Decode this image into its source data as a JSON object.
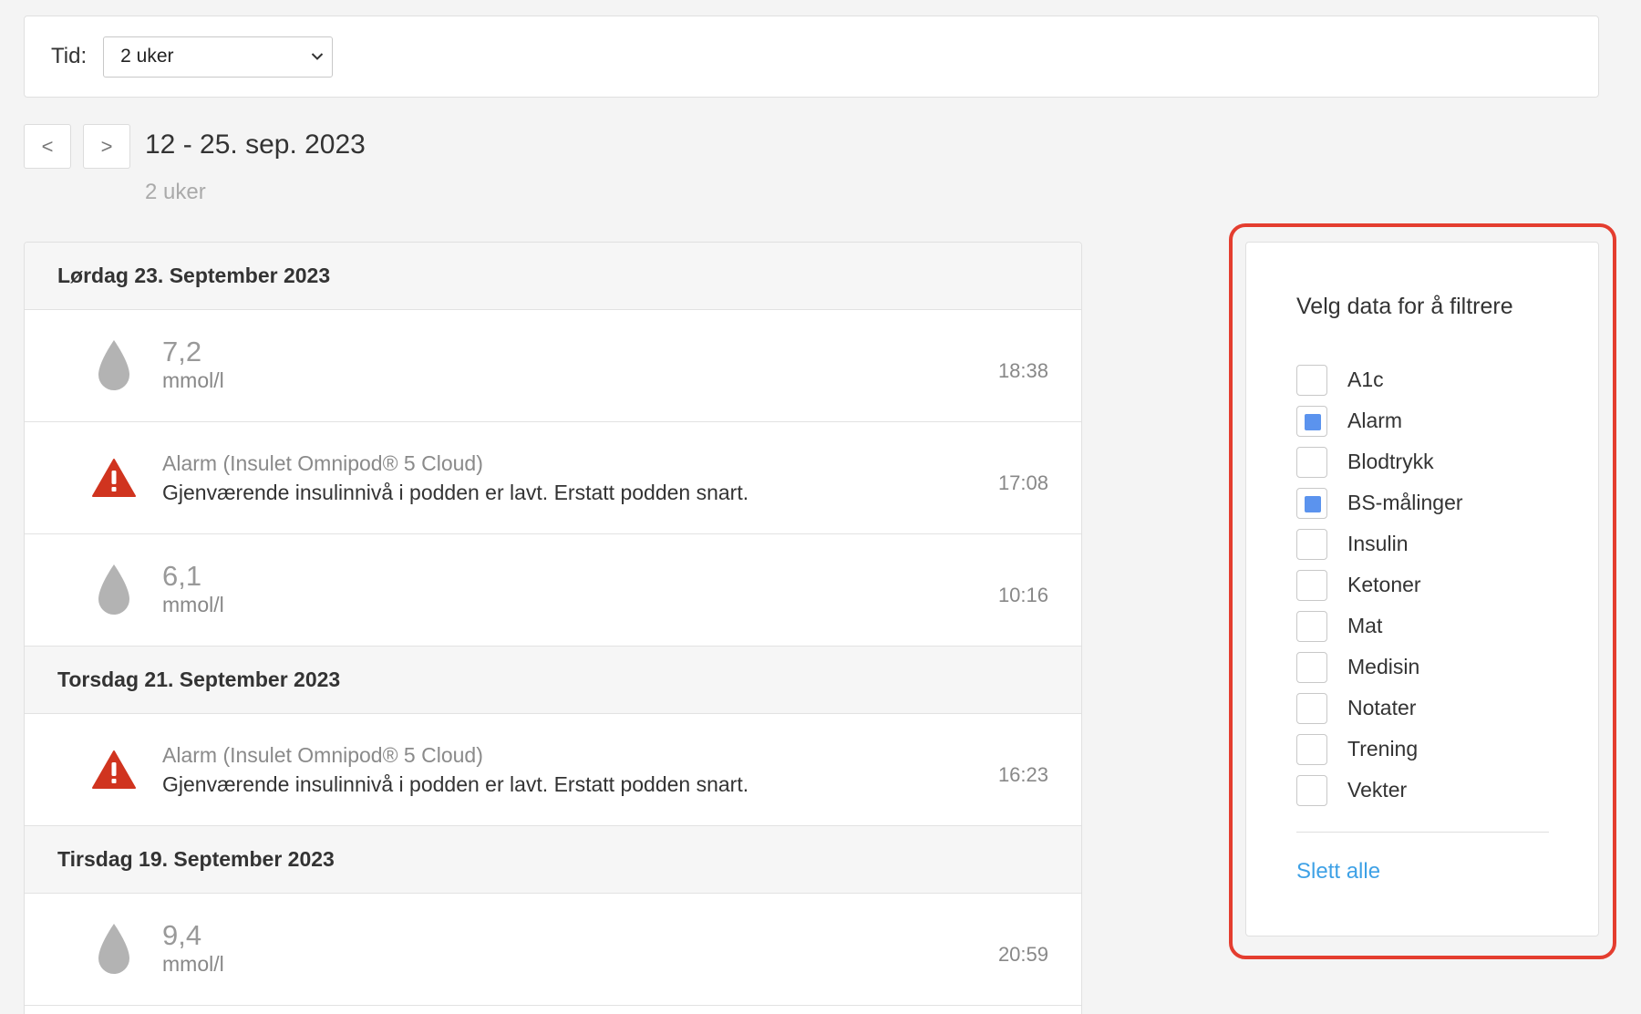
{
  "time_filter": {
    "label": "Tid:",
    "selected": "2 uker"
  },
  "period": {
    "prev_label": "<",
    "next_label": ">",
    "title": "12 - 25. sep. 2023",
    "subtitle": "2 uker"
  },
  "days": [
    {
      "header": "Lørdag 23. September 2023",
      "entries": [
        {
          "type": "bs",
          "value": "7,2",
          "unit": "mmol/l",
          "time": "18:38"
        },
        {
          "type": "alarm",
          "title": "Alarm (Insulet Omnipod® 5 Cloud)",
          "message": "Gjenværende insulinnivå i podden er lavt. Erstatt podden snart.",
          "time": "17:08"
        },
        {
          "type": "bs",
          "value": "6,1",
          "unit": "mmol/l",
          "time": "10:16"
        }
      ]
    },
    {
      "header": "Torsdag 21. September 2023",
      "entries": [
        {
          "type": "alarm",
          "title": "Alarm (Insulet Omnipod® 5 Cloud)",
          "message": "Gjenværende insulinnivå i podden er lavt. Erstatt podden snart.",
          "time": "16:23"
        }
      ]
    },
    {
      "header": "Tirsdag 19. September 2023",
      "entries": [
        {
          "type": "bs",
          "value": "9,4",
          "unit": "mmol/l",
          "time": "20:59"
        }
      ]
    }
  ],
  "filter": {
    "title": "Velg data for å filtrere",
    "options": [
      {
        "label": "A1c",
        "checked": false
      },
      {
        "label": "Alarm",
        "checked": true
      },
      {
        "label": "Blodtrykk",
        "checked": false
      },
      {
        "label": "BS-målinger",
        "checked": true
      },
      {
        "label": "Insulin",
        "checked": false
      },
      {
        "label": "Ketoner",
        "checked": false
      },
      {
        "label": "Mat",
        "checked": false
      },
      {
        "label": "Medisin",
        "checked": false
      },
      {
        "label": "Notater",
        "checked": false
      },
      {
        "label": "Trening",
        "checked": false
      },
      {
        "label": "Vekter",
        "checked": false
      }
    ],
    "clear_label": "Slett alle"
  },
  "colors": {
    "accent_checkbox": "#5b93ee",
    "link": "#3ea1e6",
    "alarm_red": "#d0341f",
    "highlight_outline": "#e43d2f",
    "drop_gray": "#b3b3b3"
  },
  "icons": {
    "bs": "blood-drop-icon",
    "alarm": "warning-triangle-icon",
    "select": "chevron-down-icon"
  }
}
